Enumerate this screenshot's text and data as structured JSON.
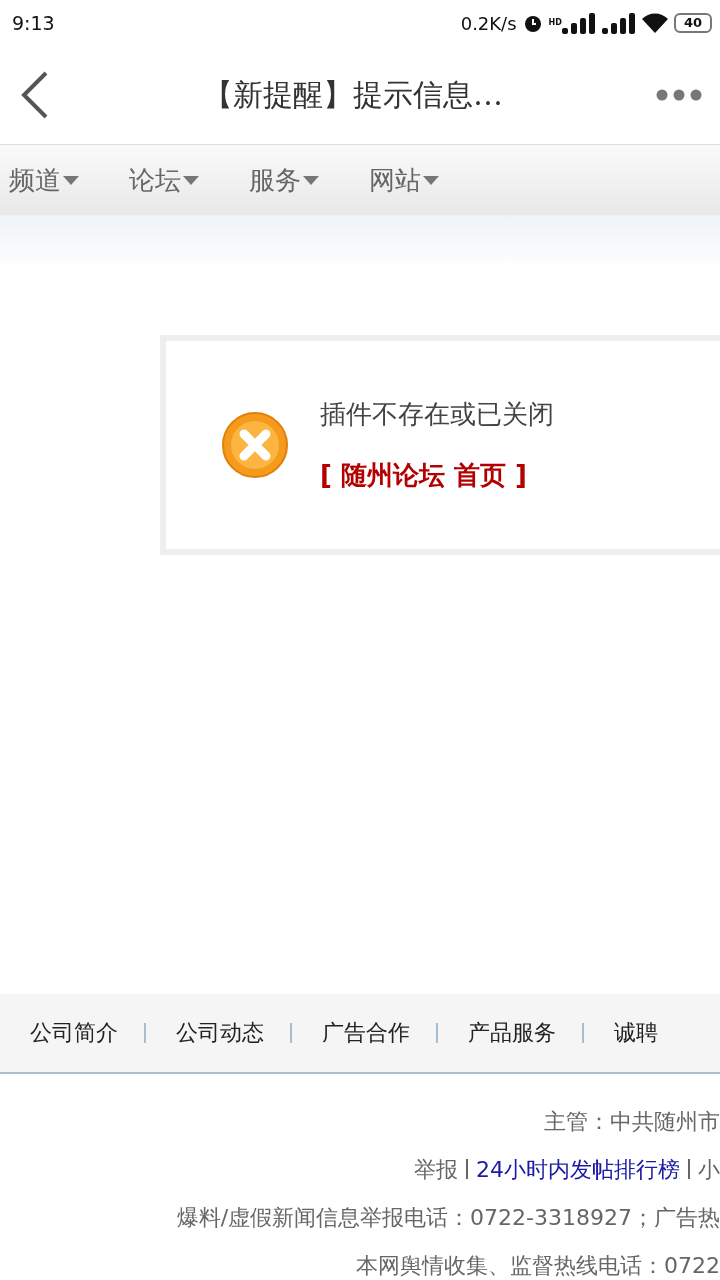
{
  "status_bar": {
    "time": "9:13",
    "speed": "0.2K/s",
    "hd": "HD",
    "battery": "40"
  },
  "header": {
    "back": true,
    "title": "【新提醒】提示信息…"
  },
  "nav": [
    {
      "label": "频道"
    },
    {
      "label": "论坛"
    },
    {
      "label": "服务"
    },
    {
      "label": "网站"
    }
  ],
  "message": {
    "text": "插件不存在或已关闭",
    "link": "[ 随州论坛 首页 ]"
  },
  "footer_links": [
    "公司简介",
    "公司动态",
    "广告合作",
    "产品服务",
    "诚聘"
  ],
  "footer_lines": [
    {
      "kind": "plain",
      "text": "主管：中共随州市"
    },
    {
      "kind": "links",
      "parts": [
        {
          "text": "举报",
          "link": false
        },
        {
          "text": "24小时内发帖排行榜",
          "link": true
        },
        {
          "text": "小",
          "link": false
        }
      ]
    },
    {
      "kind": "plain",
      "text": "爆料/虚假新闻信息举报电话：0722-3318927；广告热"
    },
    {
      "kind": "plain",
      "text": "本网舆情收集、监督热线电话：0722"
    }
  ]
}
